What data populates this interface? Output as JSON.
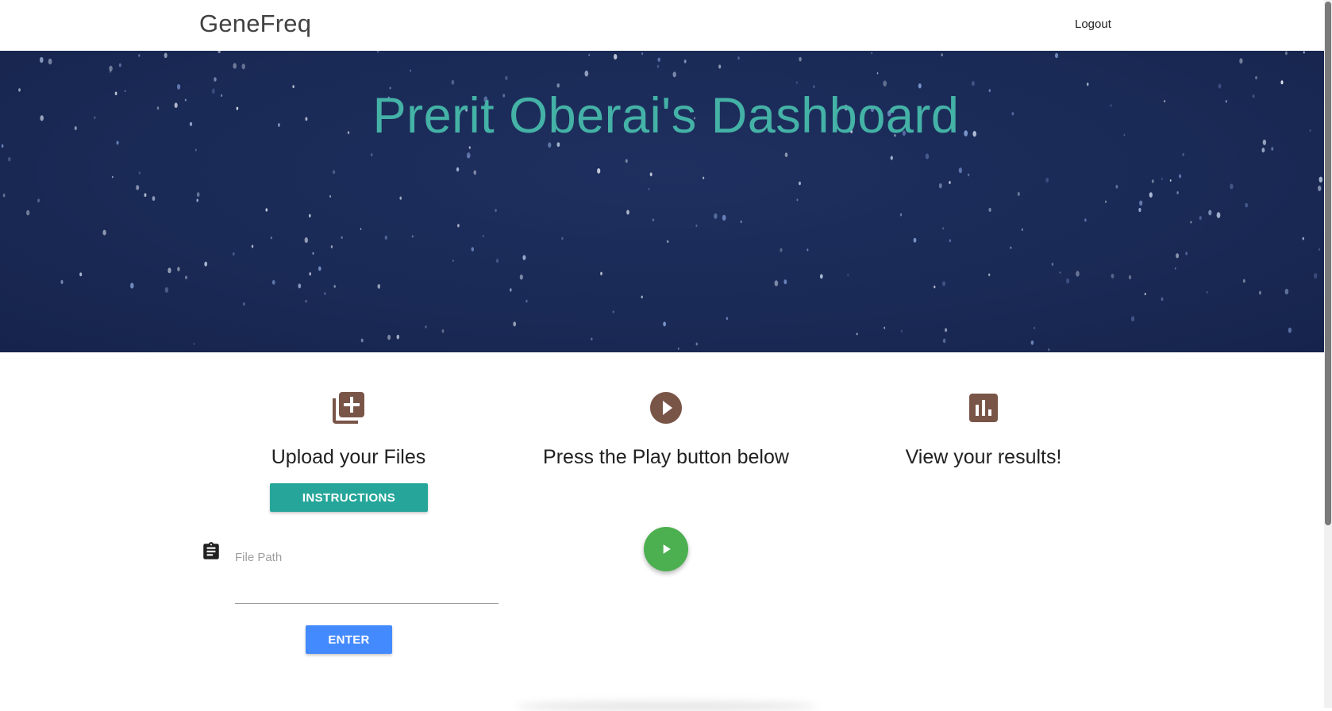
{
  "nav": {
    "brand": "GeneFreq",
    "logout_label": "Logout"
  },
  "hero": {
    "title": "Prerit Oberai's Dashboard"
  },
  "features": [
    {
      "icon": "library-add-icon",
      "heading": "Upload your Files"
    },
    {
      "icon": "play-circle-icon",
      "heading": "Press the Play button below"
    },
    {
      "icon": "assessment-icon",
      "heading": "View your results!"
    }
  ],
  "upload": {
    "instructions_label": "INSTRUCTIONS",
    "file_path_placeholder": "File Path",
    "file_path_value": "",
    "enter_label": "ENTER"
  },
  "colors": {
    "teal_accent": "#26a69a",
    "hero_title": "#44b2a6",
    "hero_bg": "#1a2a56",
    "icon_brown": "#795548",
    "play_green": "#4caf50",
    "enter_blue": "#448aff"
  }
}
